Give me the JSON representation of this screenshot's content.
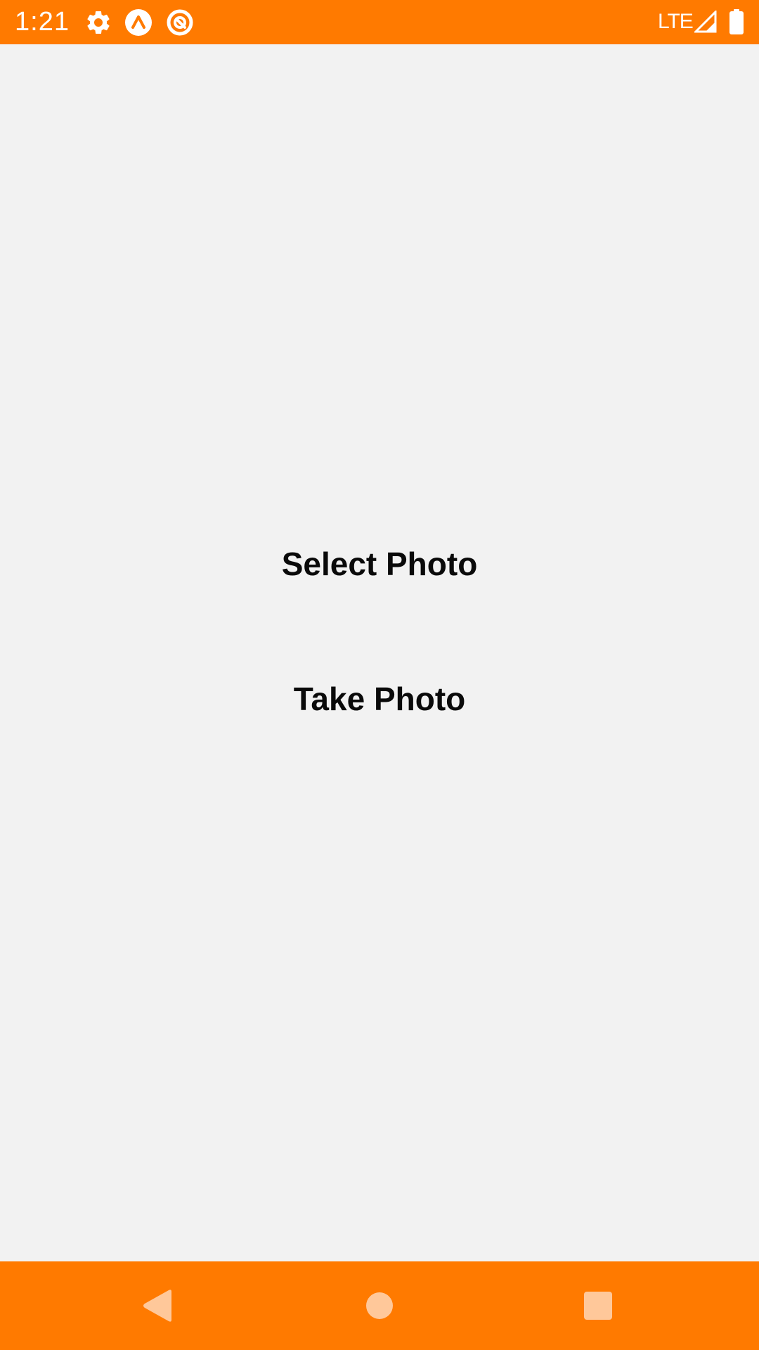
{
  "status_bar": {
    "time": "1:21",
    "network": "LTE",
    "icons": [
      "settings-gear-icon",
      "expo-icon",
      "target-app-icon",
      "signal-icon",
      "battery-icon"
    ]
  },
  "main": {
    "select_photo_label": "Select Photo",
    "take_photo_label": "Take Photo"
  },
  "nav_bar": {
    "icons": [
      "back-icon",
      "home-icon",
      "recents-icon"
    ]
  },
  "colors": {
    "accent": "#ff7a00",
    "background": "#f2f2f2",
    "text": "#0a0a0a",
    "nav_icon": "#ffc89a"
  }
}
